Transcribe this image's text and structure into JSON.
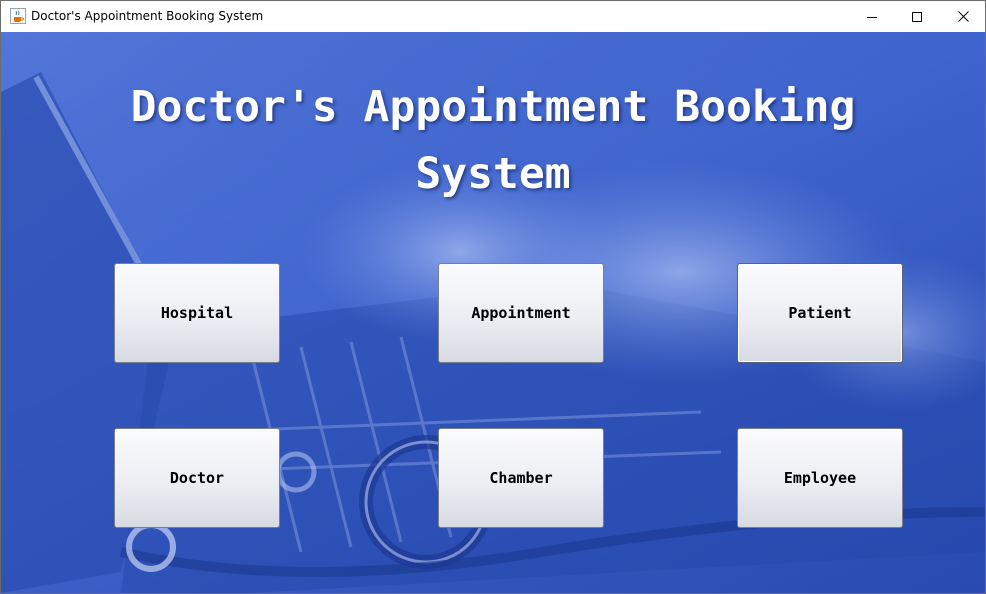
{
  "window": {
    "title": "Doctor's Appointment Booking System",
    "icon": "java-cup-icon"
  },
  "controls": {
    "minimize_icon": "minimize-icon",
    "maximize_icon": "maximize-icon",
    "close_icon": "close-icon"
  },
  "main": {
    "heading_line1": "Doctor's Appointment Booking",
    "heading_line2": "System",
    "buttons": [
      {
        "label": "Hospital"
      },
      {
        "label": "Appointment"
      },
      {
        "label": "Patient"
      },
      {
        "label": "Doctor"
      },
      {
        "label": "Chamber"
      },
      {
        "label": "Employee"
      }
    ]
  },
  "colors": {
    "background_accent": "#3a63d4",
    "heading_text": "#ffffff",
    "button_text": "#000000"
  }
}
